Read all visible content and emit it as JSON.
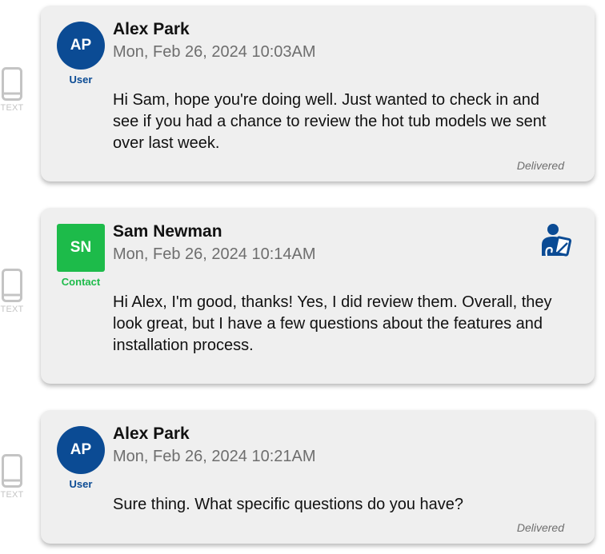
{
  "messages": [
    {
      "channel": "TEXT",
      "channel_icon": "phone-icon",
      "sender": "Alex Park",
      "initials": "AP",
      "role": "User",
      "timestamp": "Mon, Feb 26, 2024 10:03AM",
      "body": "Hi Sam, hope you're doing well. Just wanted to check in and see if you had a chance to review the hot tub models we sent over last week.",
      "status": "Delivered"
    },
    {
      "channel": "TEXT",
      "channel_icon": "phone-icon",
      "sender": "Sam Newman",
      "initials": "SN",
      "role": "Contact",
      "timestamp": "Mon, Feb 26, 2024 10:14AM",
      "body": "Hi Alex, I'm good, thanks! Yes, I did review them. Overall, they look great, but I have a few questions about the features and installation process.",
      "status": "",
      "action_icon": "agent-reply-icon"
    },
    {
      "channel": "TEXT",
      "channel_icon": "phone-icon",
      "sender": "Alex Park",
      "initials": "AP",
      "role": "User",
      "timestamp": "Mon, Feb 26, 2024 10:21AM",
      "body": "Sure thing. What specific questions do you have?",
      "status": "Delivered"
    }
  ],
  "colors": {
    "user_accent": "#0b4b94",
    "contact_accent": "#1dbb4a",
    "card_background": "#efefef",
    "muted_text": "#6e6e6e",
    "channel_icon": "#c4c4c4"
  }
}
